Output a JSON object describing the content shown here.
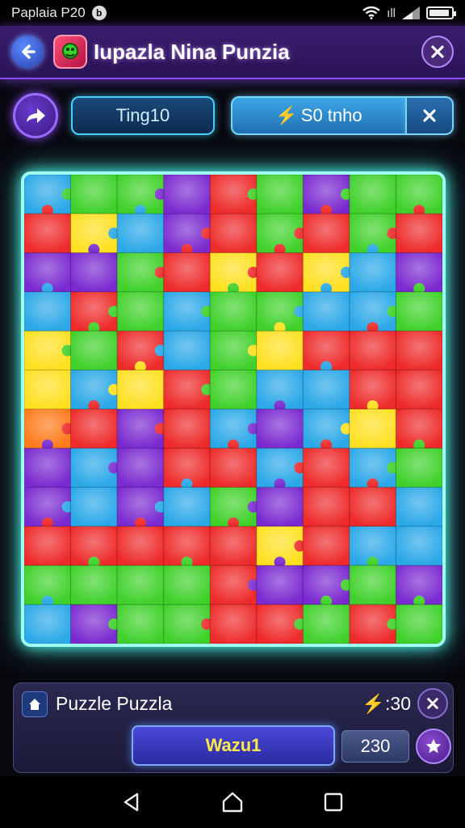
{
  "status": {
    "time": "Paplaia P20",
    "notification_glyph": "b",
    "signal_text": "ıll"
  },
  "header": {
    "title": "Iupazla Nina Punzia"
  },
  "toolbar": {
    "level_label": "Ting10",
    "energy_label": "S0 tnho"
  },
  "board": {
    "rows": 12,
    "cols": 9,
    "palette": {
      "red": "#ee2a2a",
      "green": "#3fd12a",
      "purple": "#7a2ad0",
      "blue": "#2aa8e8",
      "yellow": "#ffe020",
      "orange": "#ff7a1a"
    },
    "grid": [
      [
        "blue",
        "green",
        "green",
        "purple",
        "red",
        "green",
        "purple",
        "green",
        "green"
      ],
      [
        "red",
        "yellow",
        "blue",
        "purple",
        "red",
        "green",
        "red",
        "green",
        "red"
      ],
      [
        "purple",
        "purple",
        "green",
        "red",
        "yellow",
        "red",
        "yellow",
        "blue",
        "purple"
      ],
      [
        "blue",
        "red",
        "green",
        "blue",
        "green",
        "green",
        "blue",
        "blue",
        "green"
      ],
      [
        "yellow",
        "green",
        "red",
        "blue",
        "green",
        "yellow",
        "red",
        "red",
        "red"
      ],
      [
        "yellow",
        "blue",
        "yellow",
        "red",
        "green",
        "blue",
        "blue",
        "red",
        "red"
      ],
      [
        "orange",
        "red",
        "purple",
        "red",
        "blue",
        "purple",
        "blue",
        "yellow",
        "red"
      ],
      [
        "purple",
        "blue",
        "purple",
        "red",
        "red",
        "blue",
        "red",
        "blue",
        "green"
      ],
      [
        "purple",
        "blue",
        "purple",
        "blue",
        "green",
        "purple",
        "red",
        "red",
        "blue"
      ],
      [
        "red",
        "red",
        "red",
        "red",
        "red",
        "yellow",
        "red",
        "blue",
        "blue"
      ],
      [
        "green",
        "green",
        "green",
        "green",
        "red",
        "purple",
        "purple",
        "green",
        "purple"
      ],
      [
        "blue",
        "purple",
        "green",
        "green",
        "red",
        "red",
        "green",
        "red",
        "green"
      ]
    ]
  },
  "panel": {
    "title": "Puzzle Puzzla",
    "timer": ":30",
    "word_button": "Wazu1",
    "score": "230"
  }
}
